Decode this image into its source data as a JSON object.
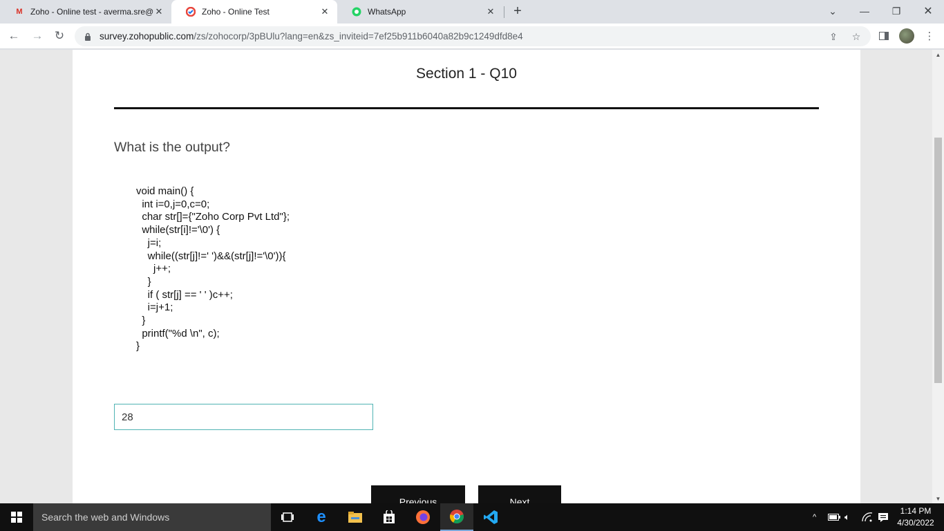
{
  "browser": {
    "tabs": [
      {
        "title": "Zoho - Online test - averma.sre@",
        "favicon": "gmail-icon",
        "active": false
      },
      {
        "title": "Zoho - Online Test",
        "favicon": "zoho-survey-icon",
        "active": true
      },
      {
        "title": "WhatsApp",
        "favicon": "whatsapp-icon",
        "active": false
      }
    ],
    "new_tab_glyph": "+",
    "url_host": "survey.zohopublic.com",
    "url_path": "/zs/zohocorp/3pBUlu?lang=en&zs_inviteid=7ef25b911b6040a82b9c1249dfd8e4"
  },
  "page": {
    "section_title": "Section 1 - Q10",
    "question": "What is the output?",
    "code": "void main() {\n  int i=0,j=0,c=0;\n  char str[]={\"Zoho Corp Pvt Ltd\"};\n  while(str[i]!='\\0') {\n    j=i;\n    while((str[j]!=' ')&&(str[j]!='\\0')){\n      j++;\n    }\n    if ( str[j] == ' ' )c++;\n    i=j+1;\n  }\n  printf(\"%d \\n\", c);\n}",
    "answer_value": "28",
    "previous_label": "Previous",
    "next_label": "Next"
  },
  "taskbar": {
    "search_placeholder": "Search the web and Windows",
    "time": "1:14 PM",
    "date": "4/30/2022"
  }
}
